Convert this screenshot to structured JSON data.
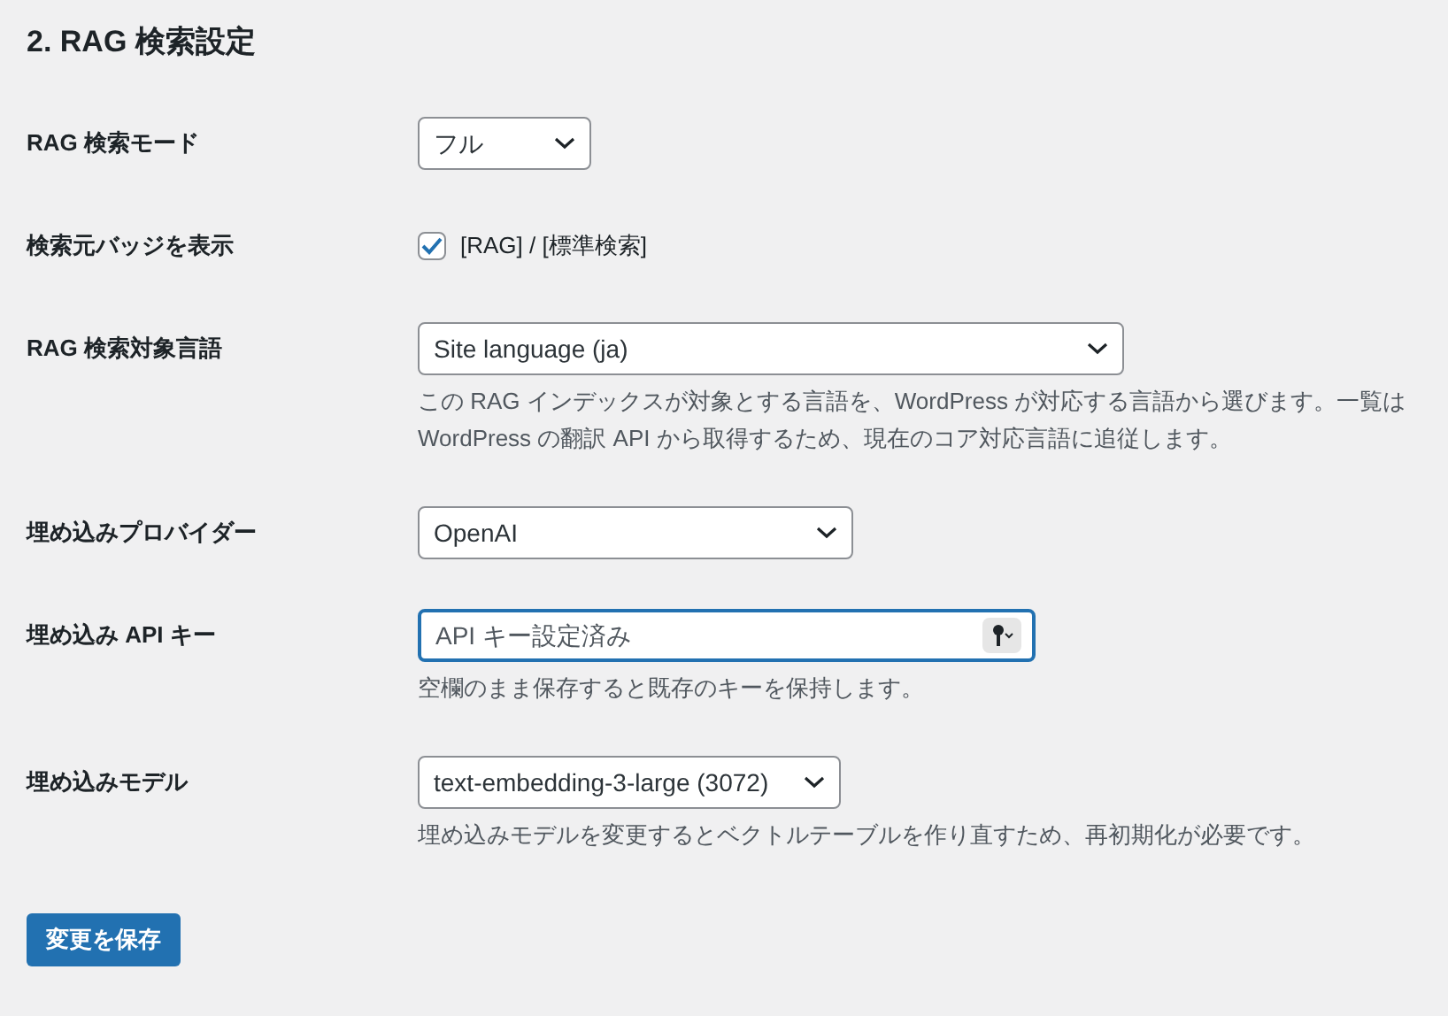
{
  "section_title": "2. RAG 検索設定",
  "fields": [
    {
      "kind": "select",
      "label": "RAG 検索モード",
      "value": "フル"
    },
    {
      "kind": "checkbox",
      "label": "検索元バッジを表示",
      "option": "[RAG] / [標準検索]",
      "checked": true
    },
    {
      "kind": "select",
      "label": "RAG 検索対象言語",
      "value": "Site language (ja)",
      "description": "この RAG インデックスが対象とする言語を、WordPress が対応する言語から選びます。一覧は WordPress の翻訳 API から取得するため、現在のコア対応言語に追従します。"
    },
    {
      "kind": "select",
      "label": "埋め込みプロバイダー",
      "value": "OpenAI"
    },
    {
      "kind": "password",
      "label": "埋め込み API キー",
      "placeholder": "API キー設定済み",
      "focused": true,
      "description": "空欄のまま保存すると既存のキーを保持します。"
    },
    {
      "kind": "select",
      "label": "埋め込みモデル",
      "value": "text-embedding-3-large (3072)",
      "description": "埋め込みモデルを変更するとベクトルテーブルを作り直すため、再初期化が必要です。"
    }
  ],
  "save_button": "変更を保存"
}
